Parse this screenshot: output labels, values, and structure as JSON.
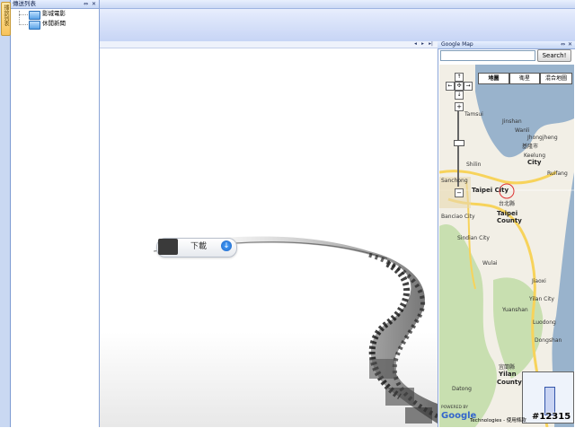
{
  "side_strip": {
    "tab_label": "播放列表"
  },
  "left_panel": {
    "title": "傳送列表",
    "pin_glyph": "⇔",
    "close_glyph": "✕",
    "tree": [
      {
        "label": "影城電影"
      },
      {
        "label": "休閒新聞"
      }
    ]
  },
  "content": {
    "nav_left": "◂",
    "nav_right": "▸",
    "nav_end": "▸|",
    "download": {
      "label": "下載",
      "icon": "download-arrow-icon"
    }
  },
  "map": {
    "title": "Google Map",
    "pin_glyph": "⇔",
    "close_glyph": "✕",
    "search": {
      "value": "",
      "button": "Search!"
    },
    "map_types": [
      "地圖",
      "衛星",
      "混合地圖"
    ],
    "active_type": "地圖",
    "places": [
      {
        "name": "Keelung",
        "big": true
      },
      {
        "name": "City",
        "big": true
      },
      {
        "name": "基隆市",
        "big": false
      },
      {
        "name": "Taipei City",
        "big": true
      },
      {
        "name": "台北縣",
        "big": false
      },
      {
        "name": "Taipei",
        "big": true
      },
      {
        "name": "County",
        "big": true
      },
      {
        "name": "Sindian City",
        "big": false
      },
      {
        "name": "Wulai",
        "big": false
      },
      {
        "name": "Jiaoxi",
        "big": false
      },
      {
        "name": "Yilan City",
        "big": false
      },
      {
        "name": "Yuanshan",
        "big": false
      },
      {
        "name": "Luodong",
        "big": false
      },
      {
        "name": "Dongshan",
        "big": false
      },
      {
        "name": "宜蘭縣",
        "big": false
      },
      {
        "name": "Yilan",
        "big": true
      },
      {
        "name": "County",
        "big": true
      },
      {
        "name": "Datong",
        "big": false
      },
      {
        "name": "Shilin",
        "big": false
      },
      {
        "name": "Sanchong",
        "big": false
      },
      {
        "name": "Banciao City",
        "big": false
      },
      {
        "name": "Jhongjheng",
        "big": false
      },
      {
        "name": "Jinshan",
        "big": false
      },
      {
        "name": "Wanli",
        "big": false
      },
      {
        "name": "Ruifang",
        "big": false
      },
      {
        "name": "Tamsui",
        "big": false
      }
    ],
    "powered_by": "POWERED BY",
    "google": "Google",
    "attribution": "Technologies - 使用條款",
    "colors": {
      "land": "#f2efe6",
      "sea": "#99b3cc",
      "road": "#f7d35b",
      "green": "#c8dfb0"
    }
  },
  "watermark": "#12315"
}
